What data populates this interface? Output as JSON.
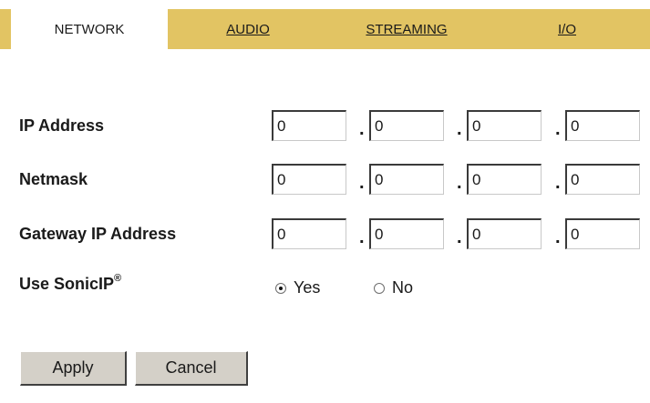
{
  "tabs": {
    "network": "NETWORK",
    "audio": "AUDIO",
    "streaming": "STREAMING",
    "io": "I/O"
  },
  "form": {
    "ip_address": {
      "label": "IP Address",
      "octets": [
        "0",
        "0",
        "0",
        "0"
      ]
    },
    "netmask": {
      "label": "Netmask",
      "octets": [
        "0",
        "0",
        "0",
        "0"
      ]
    },
    "gateway": {
      "label": "Gateway IP Address",
      "octets": [
        "0",
        "0",
        "0",
        "0"
      ]
    },
    "sonicip": {
      "label": "Use SonicIP",
      "registered_mark": "®",
      "options": {
        "yes": "Yes",
        "no": "No"
      },
      "selected": "Yes"
    },
    "separator": "."
  },
  "buttons": {
    "apply": "Apply",
    "cancel": "Cancel"
  },
  "colors": {
    "tab_bar": "#e2c463",
    "button_face": "#d4d0c8"
  }
}
